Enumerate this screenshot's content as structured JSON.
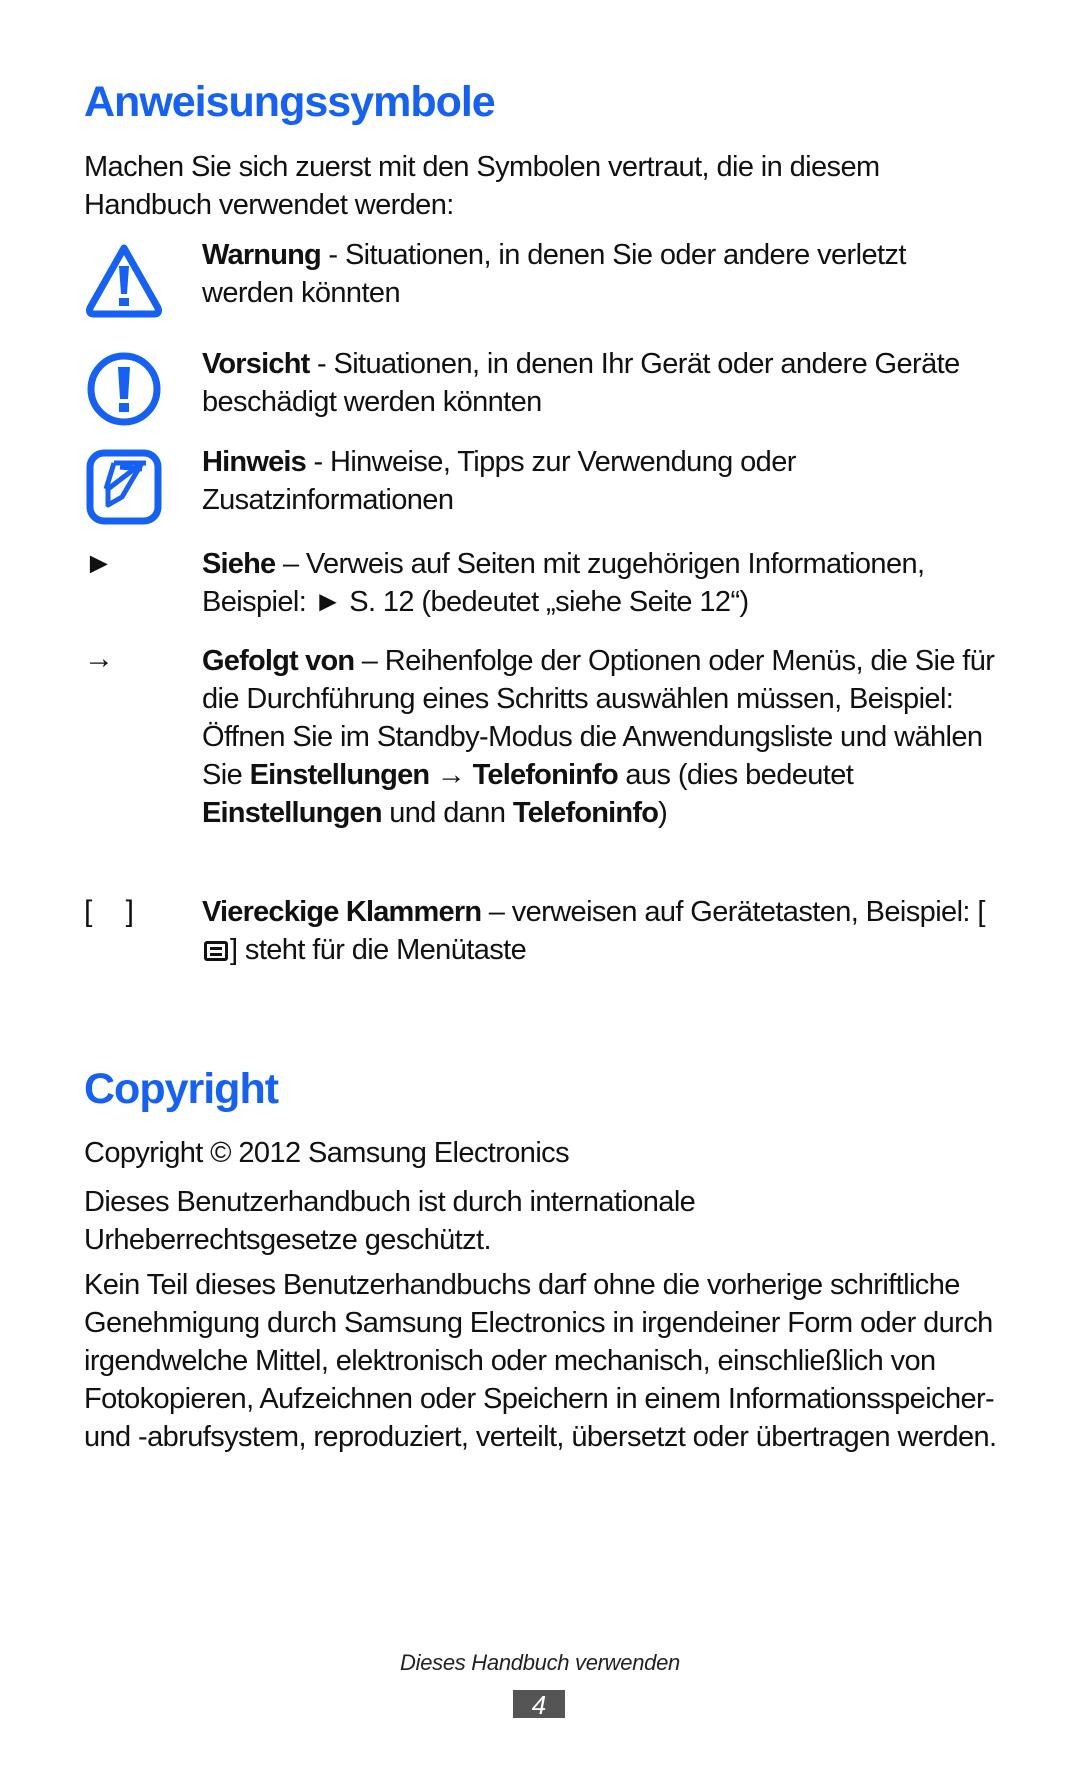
{
  "section1": {
    "title": "Anweisungssymbole",
    "intro": "Machen Sie sich zuerst mit den Symbolen vertraut, die in diesem Handbuch verwendet werden:",
    "items": [
      {
        "icon": "warning-triangle-icon",
        "term": "Warnung",
        "desc": " - Situationen, in denen Sie oder andere verletzt werden könnten"
      },
      {
        "icon": "caution-circle-icon",
        "term": "Vorsicht",
        "desc": " - Situationen, in denen Ihr Gerät oder andere Geräte beschädigt werden könnten"
      },
      {
        "icon": "note-pencil-icon",
        "term": "Hinweis",
        "desc": " - Hinweise, Tipps zur Verwendung oder Zusatzinformationen"
      },
      {
        "icon": "see-triangle-icon",
        "symbol": "►",
        "term": "Siehe",
        "desc": " – Verweis auf Seiten mit zugehörigen Informationen, Beispiel: ",
        "example_symbol": "►",
        "example_text": " S. 12 (bedeutet „siehe Seite 12“)"
      },
      {
        "icon": "arrow-right-icon",
        "symbol": "→",
        "term": "Gefolgt von",
        "desc": " – Reihenfolge der Optionen oder Menüs, die Sie für die Durchführung eines Schritts auswählen müssen, Beispiel: Öffnen Sie im Standby-Modus die Anwendungsliste und wählen Sie ",
        "ex1": "Einstellungen",
        "ex_arrow": " → ",
        "ex2": "Telefoninfo",
        "ex_mid": " aus (dies bedeutet ",
        "ex3": "Einstellungen",
        "ex_and": " und dann ",
        "ex4": "Telefoninfo",
        "ex_end": ")"
      },
      {
        "icon": "brackets-icon",
        "symbol": "[    ]",
        "term": "Viereckige Klammern",
        "desc": " – verweisen auf Gerätetasten, Beispiel: [",
        "example_icon": "menu-key-icon",
        "example_end": "] steht für die Menütaste"
      }
    ]
  },
  "section2": {
    "title": "Copyright",
    "paragraphs": [
      "Copyright © 2012 Samsung Electronics",
      "Dieses Benutzerhandbuch ist durch internationale Urheberrechtsgesetze geschützt.",
      "Kein Teil dieses Benutzerhandbuchs darf ohne die vorherige schriftliche Genehmigung durch Samsung Electronics in irgendeiner Form oder durch irgendwelche Mittel, elektronisch oder mechanisch, einschließlich von Fotokopieren, Aufzeichnen oder Speichern in einem Informationsspeicher- und -abrufsystem, reproduziert, verteilt, übersetzt oder übertragen werden."
    ]
  },
  "footer": {
    "chapter": "Dieses Handbuch verwenden",
    "page_number": "4"
  },
  "colors": {
    "accent": "#1560f5",
    "page_box": "#555555"
  }
}
